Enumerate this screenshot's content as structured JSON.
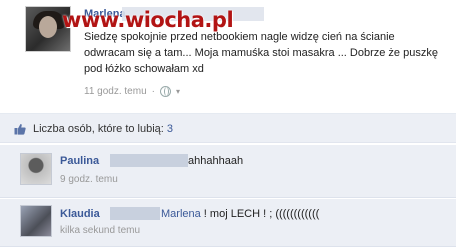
{
  "post": {
    "author_partial": "Marlena",
    "watermark": "www.wiocha.pl",
    "text": "Siedzę spokojnie przed netbookiem nagle widzę cień na ścianie odwracam się a tam... Moja mamuśka stoi masakra ... Dobrze że puszkę pod łóżko schowałam xd",
    "time": "11 godz. temu",
    "meta_separator": "·"
  },
  "likes": {
    "label": "Liczba osób, które to lubią:",
    "count": "3"
  },
  "comments": [
    {
      "author": "Paulina",
      "text": "ahhahhaah",
      "time": "9 godz. temu"
    },
    {
      "author": "Klaudia",
      "mention": "Marlena",
      "text": " ! moj LECH ! ; ((((((((((((",
      "time": "kilka sekund temu"
    }
  ],
  "colors": {
    "link": "#3b5998",
    "comment_bg": "#eceff5",
    "watermark": "#b21414"
  }
}
